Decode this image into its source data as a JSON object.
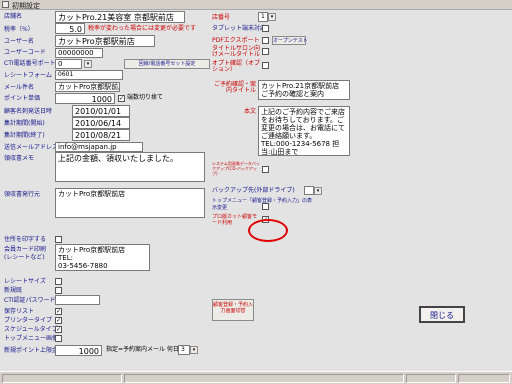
{
  "window": {
    "title": "初期設定"
  },
  "left": {
    "shop_name": {
      "label": "店舗名",
      "value": "カットPro.21美容室 京都駅前店"
    },
    "tax": {
      "label": "税率（%）",
      "value": "5.0",
      "note": "税率が変わった場合には変更が必要です"
    },
    "user_name": {
      "label": "ユーザー名",
      "value": "カットPro京都駅前店"
    },
    "user_code": {
      "label": "ユーザーコード",
      "value": "00000000"
    },
    "cti_port": {
      "label": "CTI電話番号ポート",
      "value": "0"
    },
    "cti_btn": "回線/電話番号セット設定",
    "receipt_form": {
      "label": "レシートフォーム",
      "value": "0601"
    },
    "mail_sender": {
      "label": "メール件名",
      "value": "カットPro京都駅前店"
    },
    "point_unit": {
      "label": "ポイント単価",
      "value": "1000",
      "check_label": "端数切り捨て"
    },
    "first_shipment": {
      "label": "顧客名刺発送日時",
      "value": "2010/01/01"
    },
    "period_start": {
      "label": "集計期間(開始)",
      "value": "2010/06/14"
    },
    "period_end": {
      "label": "集計期間(終了)",
      "value": "2010/08/21"
    },
    "send_mail": {
      "label": "送信メールアドレス",
      "value": "info@msjapan.jp"
    },
    "receipt_memo": {
      "label": "領収書メモ",
      "value": "上記の金額、領収いたしました。"
    },
    "receipt_shop": {
      "label": "領収書発行元",
      "value": "カットPro京都駅前店"
    },
    "print_flag": {
      "label": "住所を印字する"
    },
    "footer_text": {
      "label": "会員カード印刷(レシートなど)",
      "value": "カットPro京都駅前店\nTEL:\n03-5456-7880"
    },
    "receipt_size": {
      "label": "レシートサイズ"
    },
    "use_unit": {
      "label": "新規既"
    },
    "cti_password": {
      "label": "CTI認証パスワード"
    },
    "disp_list": {
      "label": "保存リスト"
    },
    "printer_type": {
      "label": "プリンタータイプ"
    },
    "schedule_type": {
      "label": "スケジュールタイプ"
    },
    "top_image": {
      "label": "トップメニュー画像"
    },
    "new_point": {
      "label": "新規ポイント上限金額",
      "value": "1000",
      "note": "指定=予約案内メール 何日前",
      "days": "3"
    }
  },
  "right": {
    "id_label": "店番号",
    "id_value": "1",
    "tablet_label": "タブレット端末対応",
    "pro_card_label": "PDFエクスポート",
    "pro_card_btn": "オープンテスト",
    "mail_bcc_label": "タイトルサロン向けメールタイトル",
    "option_label": "オプト確認（オプション）",
    "mail_title_label": "ご予約確認・案内タイトル",
    "mail_title_value": "カットPro.21京都駅前店 ご予約の確認と案内",
    "body_label": "本文",
    "body_value": "上記のご予約内容でご来店をお待ちしております。ご変更の場合は、お電話にてご連絡願います。TEL:000-1234-5678 担当:山田まで",
    "image_label": "システム用画像データバックアップ(CD-バックアップ)",
    "backup_label": "バックアップ先(外部ドライブ)",
    "top_menu_label": "トップメニュー「顧客登録・予約入力」の表示変更",
    "pro_menu_label": "プロ版カット顧客モード利用",
    "graph_btn": "顧客登録・予約入力画面切替",
    "close_btn": "閉じる"
  },
  "statusbar": {
    "segments": [
      "",
      "",
      "",
      ""
    ]
  },
  "colors": {
    "label": "#14148c",
    "note": "#cc0000",
    "highlight": "#e00000"
  }
}
